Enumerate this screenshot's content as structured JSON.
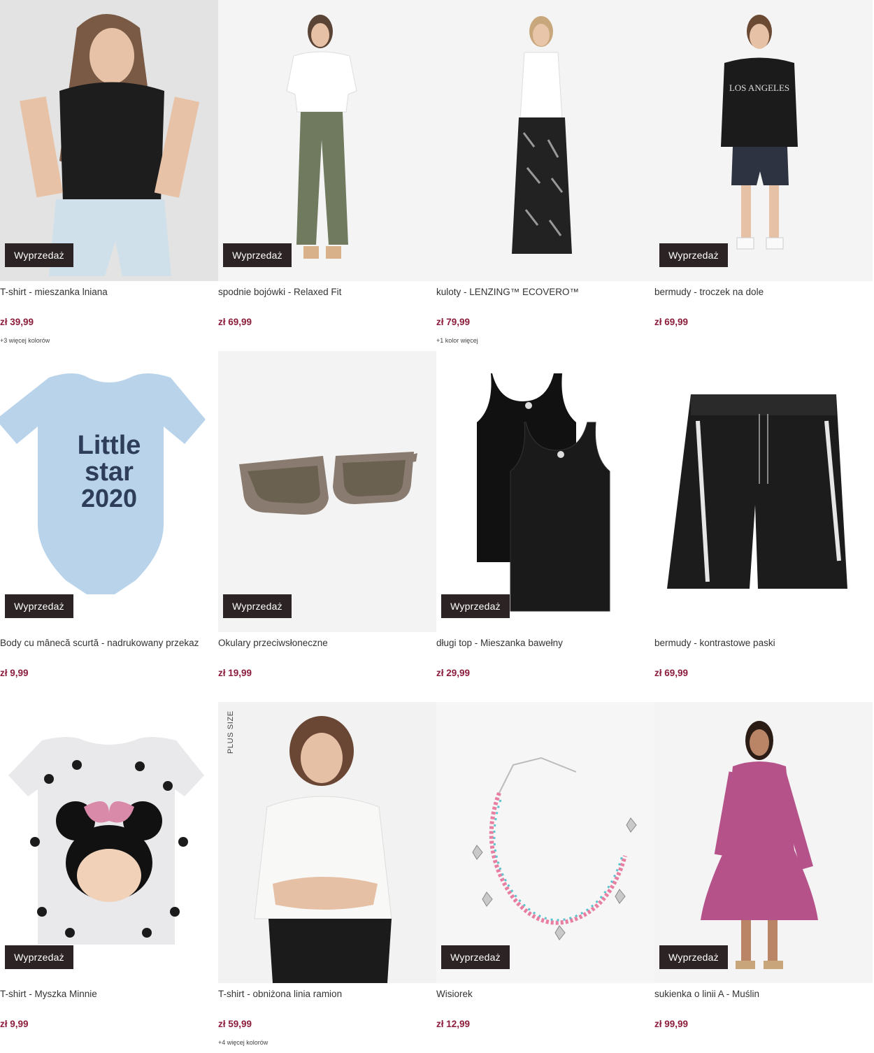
{
  "badge_label": "Wyprzedaż",
  "plus_size_label": "PLUS SIZE",
  "accent_color": "#8c1d3c",
  "badge_color": "#2b2324",
  "products": [
    {
      "name": "T-shirt - mieszanka lniana",
      "price": "zł 39,99",
      "colors": "+3 więcej kolorów",
      "badge": true
    },
    {
      "name": "spodnie bojówki - Relaxed Fit",
      "price": "zł 69,99",
      "colors": "",
      "badge": true
    },
    {
      "name": "kuloty - LENZING™ ECOVERO™",
      "price": "zł 79,99",
      "colors": "+1 kolor więcej",
      "badge": false
    },
    {
      "name": "bermudy - troczek na dole",
      "price": "zł 69,99",
      "colors": "",
      "badge": true
    },
    {
      "name": "Body cu mânecă scurtă - nadrukowany przekaz",
      "price": "zł 9,99",
      "colors": "",
      "badge": true
    },
    {
      "name": "Okulary przeciwsłoneczne",
      "price": "zł 19,99",
      "colors": "",
      "badge": true
    },
    {
      "name": "długi top - Mieszanka bawełny",
      "price": "zł 29,99",
      "colors": "",
      "badge": true
    },
    {
      "name": "bermudy - kontrastowe paski",
      "price": "zł 69,99",
      "colors": "",
      "badge": false
    },
    {
      "name": "T-shirt - Myszka Minnie",
      "price": "zł 9,99",
      "colors": "",
      "badge": true
    },
    {
      "name": "T-shirt - obniżona linia ramion",
      "price": "zł 59,99",
      "colors": "+4 więcej kolorów",
      "badge": false
    },
    {
      "name": "Wisiorek",
      "price": "zł 12,99",
      "colors": "",
      "badge": true
    },
    {
      "name": "sukienka o linii A - Muślin",
      "price": "zł 99,99",
      "colors": "",
      "badge": true
    }
  ],
  "art_text": {
    "body_print_1": "Little",
    "body_print_2": "star",
    "body_print_3": "2020"
  }
}
